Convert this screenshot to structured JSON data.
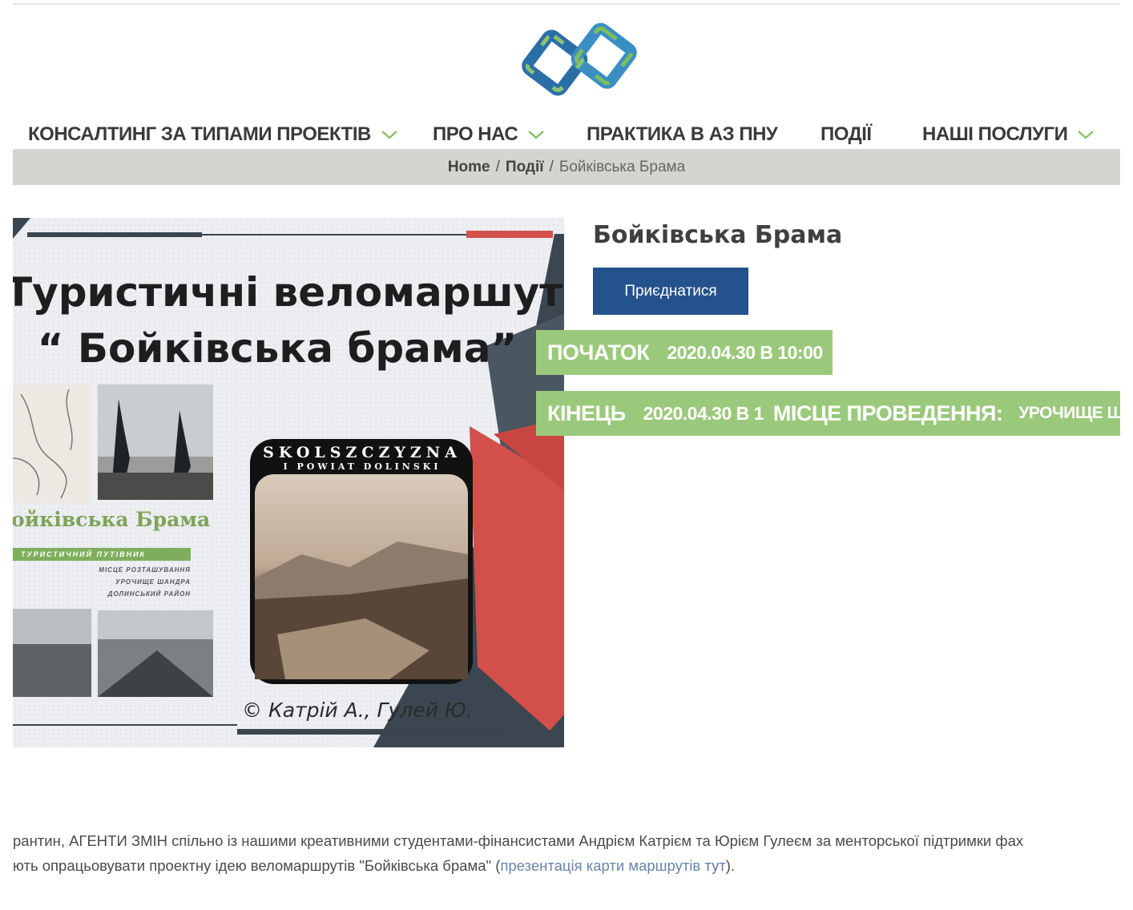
{
  "nav": {
    "items": [
      {
        "label": "КОНСАЛТИНГ ЗА ТИПАМИ ПРОЕКТІВ",
        "dropdown": true
      },
      {
        "label": "ПРО НАС",
        "dropdown": true
      },
      {
        "label": "ПРАКТИКА В АЗ ПНУ",
        "dropdown": false
      },
      {
        "label": "ПОДІЇ",
        "dropdown": false
      },
      {
        "label": "НАШІ ПОСЛУГИ",
        "dropdown": true
      }
    ]
  },
  "breadcrumb": {
    "home": "Home",
    "sep": "/",
    "section": "Події",
    "current": "Бойківська Брама"
  },
  "poster": {
    "title_line1": "Туристичні веломаршути",
    "title_line2": "“ Бойківська брама”",
    "guide_title": "ойківська Брама",
    "guide_bar": "ТУРИСТИЧНИЙ ПУТІВНИК",
    "guide_sub1": "МІСЦЕ РОЗТАШУВАННЯ",
    "guide_sub2": "УРОЧИЩЕ ШАНДРА",
    "guide_sub3": "ДОЛИНСЬКИЙ РАЙОН",
    "stamp_line1": "SKOLSZCZYZNA",
    "stamp_line2": "I POWIAT DOLINSKI",
    "credit": "© Катрій А., Гулей Ю."
  },
  "event": {
    "title": "Бойківська Брама",
    "join_label": "Приєднатися",
    "start_label": "ПОЧАТОК",
    "start_value": "2020.04.30 В 10:00",
    "end_label": "КІНЕЦЬ",
    "end_value": "2020.04.30 В 1",
    "place_label": "МІСЦЕ ПРОВЕДЕННЯ:",
    "place_value": "УРОЧИЩЕ ШАН"
  },
  "description": {
    "line1": "рантин, АГЕНТИ ЗМІН спільно із нашими креативними студентами-фінансистами Андрієм Катрієм та Юрієм Гулеєм за менторської підтримки фах",
    "line2_a": "ють опрацьовувати проектну ідею веломаршрутів \"Бойківська брама\" (",
    "line2_b": "презентація карти маршрутів",
    "line2_link": "тут",
    "line2_c": ")."
  },
  "colors": {
    "nav_text": "#3a3a3a",
    "crumb_bg": "#d5d4d0",
    "button_bg": "#24528c",
    "green_bar": "#9bc97c",
    "link": "#5a78a8"
  },
  "icons": [
    "logo-icon",
    "chevron-down-icon"
  ]
}
